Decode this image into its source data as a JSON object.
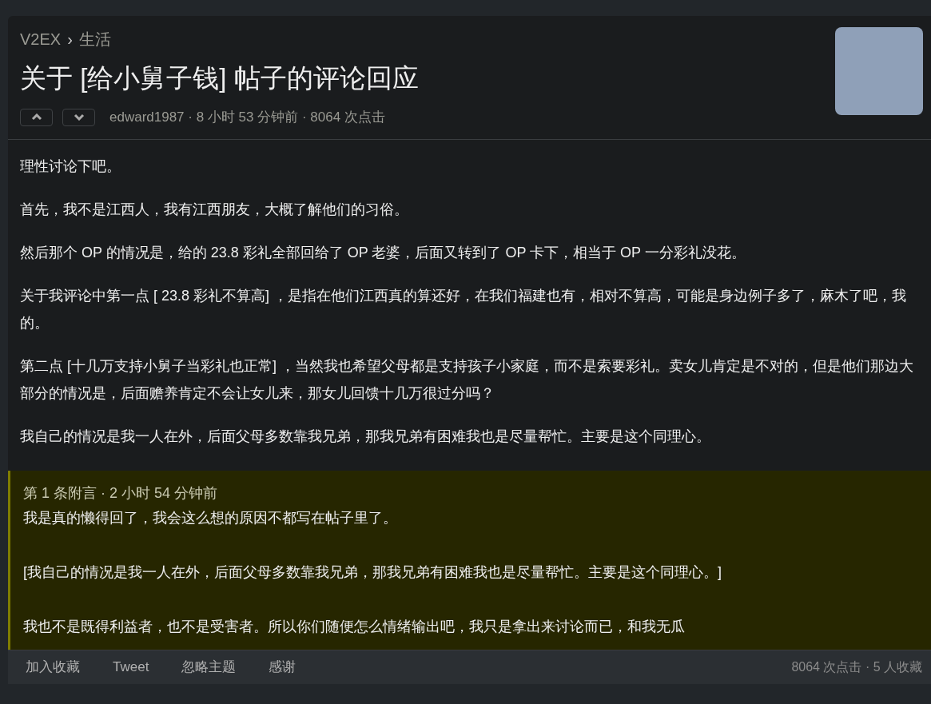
{
  "breadcrumb": {
    "site": "V2EX",
    "separator": "›",
    "node": "生活"
  },
  "title": "关于 [给小舅子钱] 帖子的评论回应",
  "meta": "edward1987 · 8 小时 53 分钟前 · 8064 次点击",
  "content": [
    "理性讨论下吧。",
    "首先，我不是江西人，我有江西朋友，大概了解他们的习俗。",
    "然后那个 OP 的情况是，给的 23.8 彩礼全部回给了 OP 老婆，后面又转到了 OP 卡下，相当于 OP 一分彩礼没花。",
    "关于我评论中第一点 [ 23.8 彩礼不算高] ，是指在他们江西真的算还好，在我们福建也有，相对不算高，可能是身边例子多了，麻木了吧，我的。",
    "第二点 [十几万支持小舅子当彩礼也正常] ，当然我也希望父母都是支持孩子小家庭，而不是索要彩礼。卖女儿肯定是不对的，但是他们那边大部分的情况是，后面赡养肯定不会让女儿来，那女儿回馈十几万很过分吗？",
    "我自己的情况是我一人在外，后面父母多数靠我兄弟，那我兄弟有困难我也是尽量帮忙。主要是这个同理心。"
  ],
  "supplement": {
    "header": "第 1 条附言 · 2 小时 54 分钟前",
    "lines": [
      "我是真的懒得回了，我会这么想的原因不都写在帖子里了。",
      "[我自己的情况是我一人在外，后面父母多数靠我兄弟，那我兄弟有困难我也是尽量帮忙。主要是这个同理心。]",
      "我也不是既得利益者，也不是受害者。所以你们随便怎么情绪输出吧，我只是拿出来讨论而已，和我无瓜"
    ]
  },
  "footer": {
    "actions": [
      "加入收藏",
      "Tweet",
      "忽略主题",
      "感谢"
    ],
    "stats": "8064 次点击 · 5 人收藏"
  }
}
